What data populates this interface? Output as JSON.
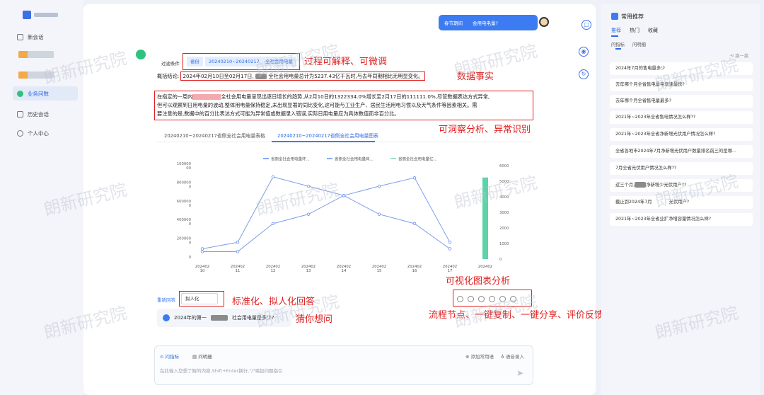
{
  "sidebar": {
    "items": [
      {
        "label": "新会话",
        "icon": "new-chat-icon"
      },
      {
        "label": "业务问数",
        "icon": "business-query-icon"
      },
      {
        "label": "历史会话",
        "icon": "history-icon"
      },
      {
        "label": "个人中心",
        "icon": "user-center-icon"
      }
    ]
  },
  "header": {
    "question_left": "春节期间",
    "question_right": "会用电电量?"
  },
  "filters": {
    "label": "过滤条件",
    "tags": [
      "省份",
      "20240210~20240217",
      "全社会用电量"
    ]
  },
  "summary": {
    "label": "概括结论:",
    "text_a": "2024年02月10日至02月17日,",
    "text_b": "全社会用电量总计为5237.43亿千瓦时,与去年同期相比无明显变化。"
  },
  "analysis": {
    "line1_a": "在指定的一周内",
    "line1_b": "全社会用电量呈现出逐日增长的趋势,从2月10日的1322334.0%增长至2月17日的111111.0%,尽管数据表达方式异常,",
    "line2": "但可以观察到日用电量的波动,整体用电量保持稳定,未出现显著的同比变化,这可能与工业生产、居民生活用电习惯以及天气条件等因素相关。需",
    "line3": "要注意的是,数据中的百分比表达方式可能为异常值或数据录入错误,实际日用电量应为具体数值而非百分比。"
  },
  "result_tabs": [
    "20240210~20240217省侧全社会用电量表格",
    "20240210~20240217省侧全社会用电量图表"
  ],
  "annotations": {
    "filters": "过程可解释、可微调",
    "summary": "数据事实",
    "analysis": "可洞察分析、异常识别",
    "chart": "可视化图表分析",
    "style": "标准化、拟人化回答",
    "guess": "猜你想问",
    "actions": "流程节点、一键复制、一键分享、评价反馈"
  },
  "answer_style": {
    "retry": "重新回答",
    "selected": "拟人化"
  },
  "guess_question": "2024年的第一",
  "guess_question_tail": "社会用电量是多少?",
  "input": {
    "tab1": "问指标",
    "tab2": "问明细",
    "add_common": "添加常用语",
    "voice": "语音录入",
    "placeholder": "在此输入您想了解的内容,Shift+Enter换行,\"/\"唤起问题指引"
  },
  "right_panel": {
    "title": "常用推荐",
    "tabs": [
      "推荐",
      "热门",
      "收藏"
    ],
    "subtabs": [
      "问指标",
      "问明细"
    ],
    "refresh": "换一换",
    "items": [
      "2024年7月的售电量多少",
      "去年哪个月全省售电量电增速最快?",
      "去年哪个月全省售电量最多?",
      "2021年~2023年全省售电情况怎么样??",
      "2021年~2023年全省净新增光伏用户情况怎么样?",
      "全省各地市2024年7月净新增光伏用户数量排名前三的是哪...",
      "7月全省光伏用户情况怎么样??",
      "近三个月,",
      "截止到2024年7月",
      "2021年~2023年全省业扩净增容量情况怎么样?"
    ],
    "items_tail": {
      "7": "净新增少光伏用户??",
      "8": "光伏用户?"
    }
  },
  "watermark": "朗新研究院",
  "chart_data": {
    "type": "line",
    "categories": [
      "20240210",
      "20240211",
      "20240212",
      "20240213",
      "20240214",
      "20240215",
      "20240216",
      "20240217",
      "20240217"
    ],
    "x_tick_labels": [
      [
        "202402",
        "10"
      ],
      [
        "202402",
        "11"
      ],
      [
        "202402",
        "12"
      ],
      [
        "202402",
        "13"
      ],
      [
        "202402",
        "14"
      ],
      [
        "202402",
        "15"
      ],
      [
        "202402",
        "16"
      ],
      [
        "202402",
        "17"
      ],
      [
        "202402",
        ""
      ]
    ],
    "y_left_ticks": [
      [
        "0"
      ],
      [
        "200000",
        "0"
      ],
      [
        "400000",
        "0"
      ],
      [
        "600000",
        "0"
      ],
      [
        "800000",
        "0"
      ],
      [
        "100000",
        "00"
      ]
    ],
    "y_left_range": [
      0,
      10000000
    ],
    "y_right_ticks": [
      "0",
      "1000",
      "2000",
      "3000",
      "4000",
      "5000",
      "6000"
    ],
    "y_right_range": [
      0,
      6000
    ],
    "legend": [
      "省侧全社会用电量环...",
      "省侧全社会用电量同...",
      "省侧全社会用电量亿..."
    ],
    "legend_colors": [
      "#5b8ff9",
      "#5b8ff9",
      "#7bd4c0"
    ],
    "series": [
      {
        "name": "省侧全社会用电量环...",
        "axis": "left",
        "values": [
          1100000,
          1800000,
          8800000,
          7800000,
          6800000,
          7800000,
          8700000,
          1800000
        ]
      },
      {
        "name": "省侧全社会用电量同...",
        "axis": "left",
        "values": [
          800000,
          800000,
          3800000,
          4800000,
          6800000,
          4800000,
          3800000,
          1100000
        ]
      },
      {
        "name": "省侧全社会用电量亿...",
        "axis": "right",
        "type": "bar",
        "values": [
          null,
          null,
          null,
          null,
          null,
          null,
          null,
          null,
          5237.43
        ]
      }
    ],
    "grid": false,
    "legend_position": "top"
  }
}
